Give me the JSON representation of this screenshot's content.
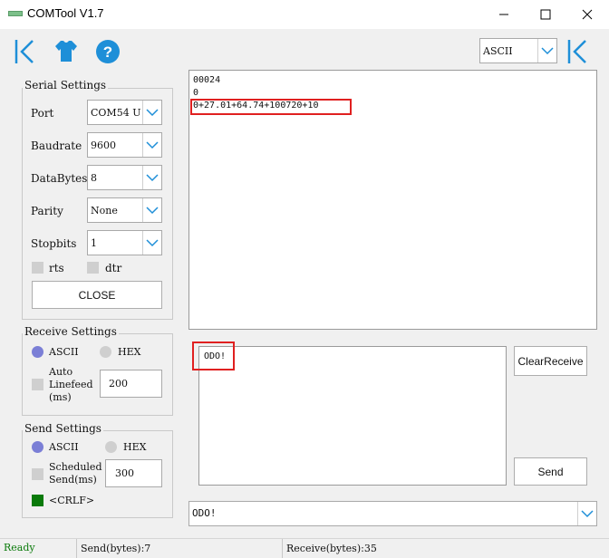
{
  "window": {
    "title": "COMTool V1.7"
  },
  "toolbar": {
    "encoding_value": "ASCII"
  },
  "serial": {
    "title": "Serial Settings",
    "port_label": "Port",
    "port_value": "COM54 U",
    "baud_label": "Baudrate",
    "baud_value": "9600",
    "databytes_label": "DataBytes",
    "databytes_value": "8",
    "parity_label": "Parity",
    "parity_value": "None",
    "stopbits_label": "Stopbits",
    "stopbits_value": "1",
    "rts_label": "rts",
    "dtr_label": "dtr",
    "close_label": "CLOSE"
  },
  "receive_settings": {
    "title": "Receive Settings",
    "ascii_label": "ASCII",
    "hex_label": "HEX",
    "autolf_label_1": "Auto",
    "autolf_label_2": "Linefeed",
    "autolf_label_3": "(ms)",
    "autolf_value": "200"
  },
  "send_settings": {
    "title": "Send Settings",
    "ascii_label": "ASCII",
    "hex_label": "HEX",
    "sched_label_1": "Scheduled",
    "sched_label_2": "Send(ms)",
    "sched_value": "300",
    "crlf_label": "<CRLF>"
  },
  "receive": {
    "lines": [
      "00024",
      "0",
      "0+27.01+64.74+100720+10"
    ]
  },
  "send": {
    "text": "ODO!",
    "clear_label": "ClearReceive",
    "send_label": "Send",
    "history_value": "ODO!"
  },
  "status": {
    "state": "Ready",
    "sent": "Send(bytes):7",
    "received": "Receive(bytes):35"
  },
  "colors": {
    "accent": "#1e8fd8",
    "radio_on": "#7b7fd6",
    "radio_off": "#cfcfcf",
    "crlf_on": "#0a7a0a",
    "highlight": "#e02020",
    "ready": "#0a7a0a"
  }
}
